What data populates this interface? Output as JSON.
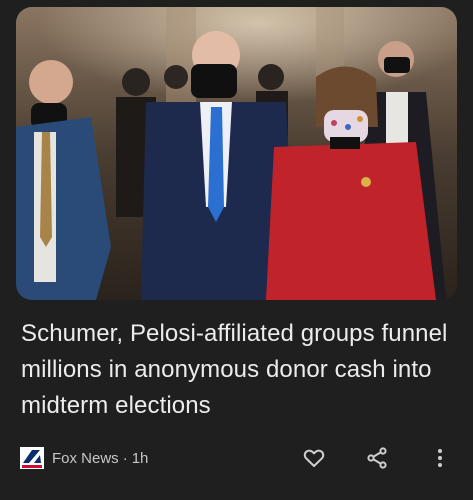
{
  "article": {
    "headline": "Schumer, Pelosi-affiliated groups funnel millions in anonymous donor cash into midterm elections",
    "source": "Fox News",
    "separator": "·",
    "age": "1h"
  },
  "icons": {
    "source_logo": "fox-news-logo",
    "like": "heart-outline-icon",
    "share": "share-icon",
    "more": "more-vert-icon"
  },
  "colors": {
    "background": "#1f1f1f",
    "text": "#ececec",
    "meta_text": "#c6c6c6",
    "icon": "#cfcfcf"
  }
}
